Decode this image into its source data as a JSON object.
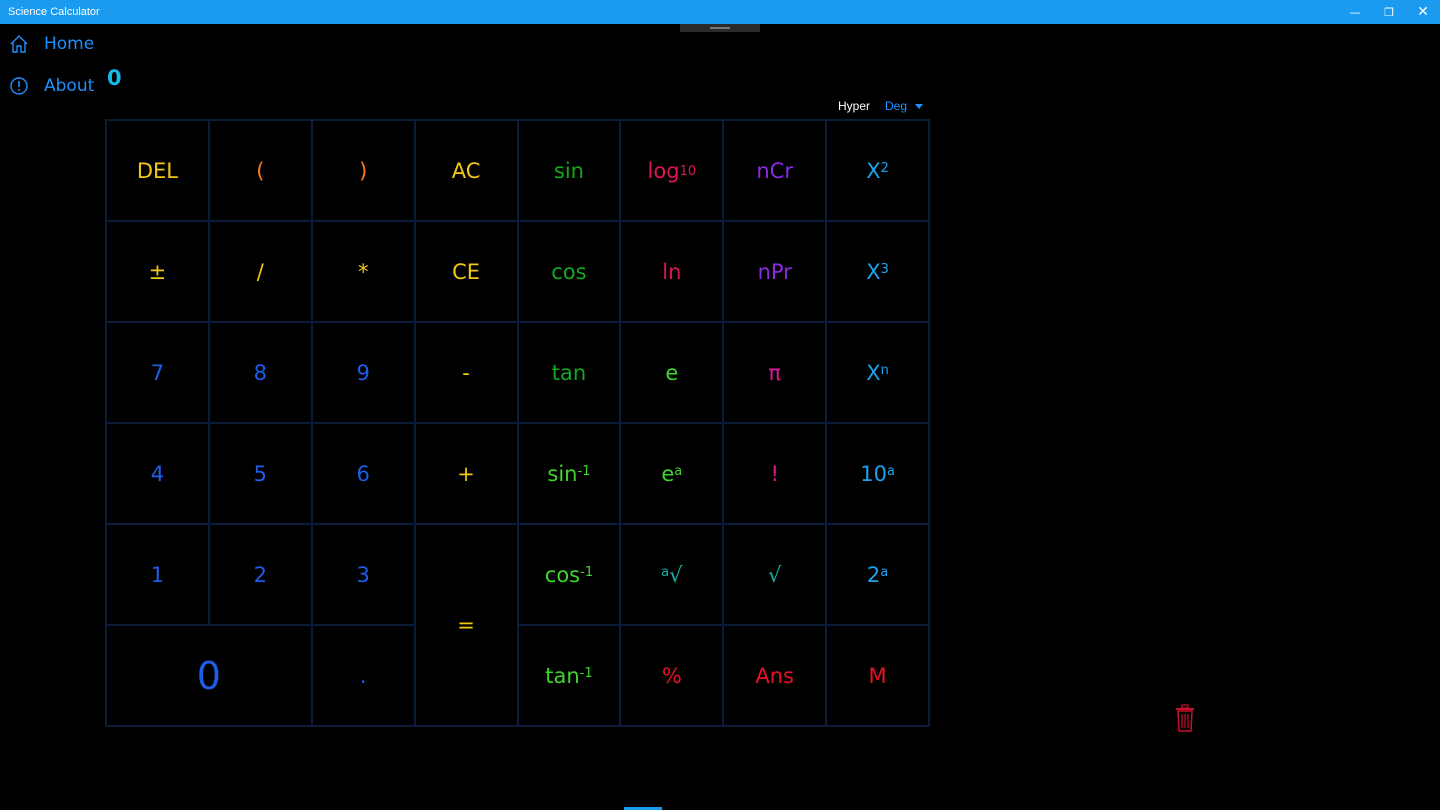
{
  "window": {
    "title": "Science Calculator"
  },
  "nav": {
    "home": "Home",
    "about": "About"
  },
  "display": {
    "value": "0"
  },
  "options": {
    "hyper": "Hyper",
    "angle_mode": "Deg"
  },
  "colors": {
    "yellow": "#f2c811",
    "orange": "#ff7a1a",
    "green": "#13a91f",
    "bright_green": "#3fd62c",
    "crimson": "#e0144f",
    "purple": "#8a2be2",
    "cyan": "#1aa3ef",
    "blue": "#1e5de8",
    "magenta": "#e0169c",
    "red": "#e81123",
    "teal": "#17b3a7"
  },
  "keys": {
    "del": "DEL",
    "lparen": "(",
    "rparen": ")",
    "ac": "AC",
    "sin": "sin",
    "log": "log",
    "log_sub": "10",
    "ncr": "nCr",
    "x": "X",
    "sq": "2",
    "plusminus": "±",
    "div": "/",
    "mul": "*",
    "ce": "CE",
    "cos": "cos",
    "ln": "ln",
    "npr": "nPr",
    "cube": "3",
    "seven": "7",
    "eight": "8",
    "nine": "9",
    "minus": "-",
    "tan": "tan",
    "e": "e",
    "pi": "π",
    "n": "n",
    "four": "4",
    "five": "5",
    "six": "6",
    "plus": "+",
    "inv": "-1",
    "a": "a",
    "fact": "!",
    "ten": "10",
    "one": "1",
    "two": "2",
    "three": "3",
    "equals": "=",
    "root": "√",
    "zero": "0",
    "dot": ".",
    "percent": "%",
    "ans": "Ans",
    "mem": "M"
  }
}
